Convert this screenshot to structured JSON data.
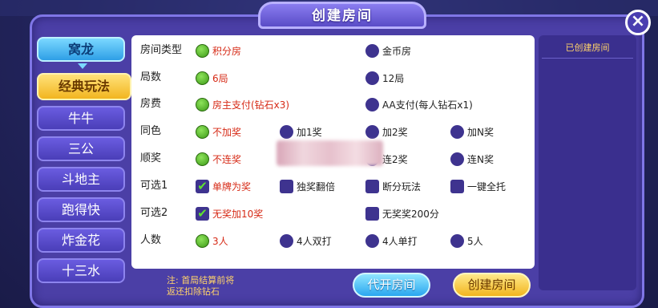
{
  "title": "创建房间",
  "close_icon": "close-icon",
  "nav": {
    "mode": "窝龙",
    "items": [
      "经典玩法",
      "牛牛",
      "三公",
      "斗地主",
      "跑得快",
      "炸金花",
      "十三水"
    ],
    "active_index": 0
  },
  "rows": [
    {
      "label": "房间类型",
      "options": [
        {
          "text": "积分房",
          "on": true
        },
        {
          "text": "金币房",
          "on": false
        }
      ]
    },
    {
      "label": "局数",
      "options": [
        {
          "text": "6局",
          "on": true
        },
        {
          "text": "12局",
          "on": false
        }
      ]
    },
    {
      "label": "房费",
      "options": [
        {
          "text": "房主支付(钻石x3)",
          "on": true
        },
        {
          "text": "AA支付(每人钻石x1)",
          "on": false
        }
      ]
    },
    {
      "label": "同色",
      "options": [
        {
          "text": "不加奖",
          "on": true
        },
        {
          "text": "加1奖",
          "on": false
        },
        {
          "text": "加2奖",
          "on": false
        },
        {
          "text": "加N奖",
          "on": false
        }
      ]
    },
    {
      "label": "顺奖",
      "options": [
        {
          "text": "不连奖",
          "on": true
        },
        {
          "text": "",
          "on": false
        },
        {
          "text": "连2奖",
          "on": false
        },
        {
          "text": "连N奖",
          "on": false
        }
      ]
    },
    {
      "label": "可选1",
      "options": [
        {
          "text": "单牌为奖",
          "on": true
        },
        {
          "text": "独奖翻倍",
          "on": false
        },
        {
          "text": "断分玩法",
          "on": false
        },
        {
          "text": "一键全托",
          "on": false
        }
      ]
    },
    {
      "label": "可选2",
      "options": [
        {
          "text": "无奖加10奖",
          "on": true
        },
        {
          "text": "无奖奖200分",
          "on": false
        }
      ]
    },
    {
      "label": "人数",
      "options": [
        {
          "text": "3人",
          "on": true
        },
        {
          "text": "4人双打",
          "on": false
        },
        {
          "text": "4人单打",
          "on": false
        },
        {
          "text": "5人",
          "on": false
        }
      ]
    }
  ],
  "right_panel": {
    "title": "已创建房间"
  },
  "note": {
    "line1": "注: 首局结算前将",
    "line2": "返还扣除钻石"
  },
  "buttons": {
    "proxy": "代开房间",
    "create": "创建房间"
  },
  "colors": {
    "accent": "#4b3fa6",
    "selected_text": "#d62a16",
    "radio_on": "#3d9a18",
    "create_button": "#f2b51f",
    "proxy_button": "#2aa6ef"
  }
}
